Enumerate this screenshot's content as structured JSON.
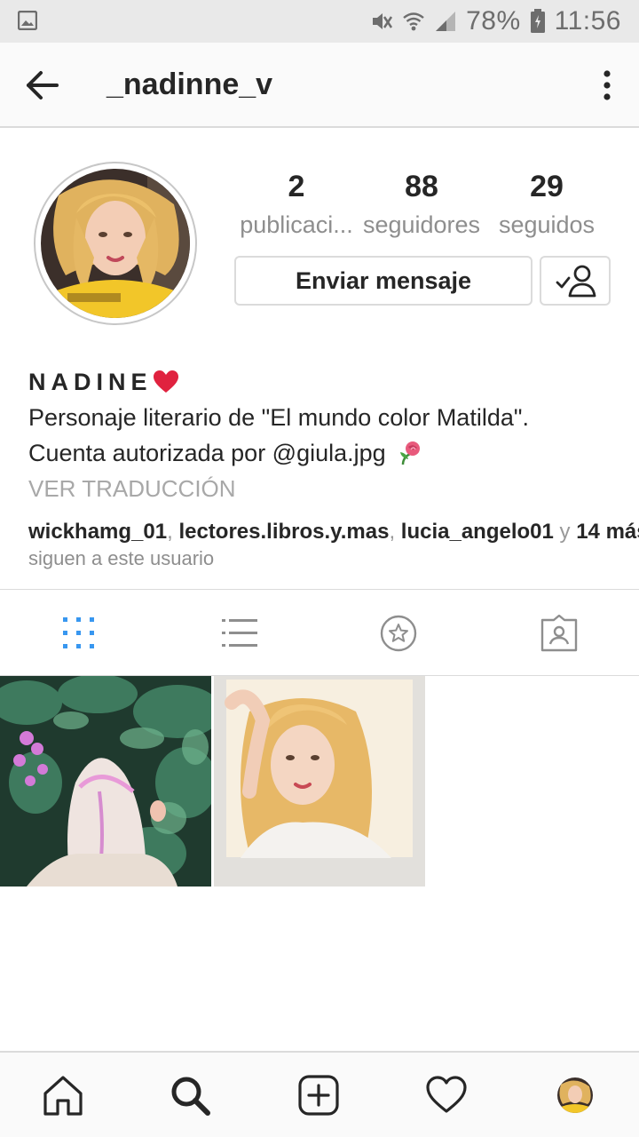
{
  "status_bar": {
    "battery": "78%",
    "time": "11:56",
    "icons": [
      "gallery-icon",
      "mute-icon",
      "wifi-icon",
      "signal-icon",
      "battery-icon"
    ]
  },
  "header": {
    "username": "_nadinne_v",
    "icons": [
      "back-arrow-icon",
      "more-vertical-icon"
    ]
  },
  "profile": {
    "stats": [
      {
        "value": "2",
        "label": "publicaci..."
      },
      {
        "value": "88",
        "label": "seguidores"
      },
      {
        "value": "29",
        "label": "seguidos"
      }
    ],
    "message_button": "Enviar mensaje",
    "following_icon": "following-check-icon"
  },
  "bio": {
    "name": "NADINE",
    "line1": "Personaje literario de \"El mundo color Matilda\".",
    "line2": "Cuenta autorizada por @giula.jpg",
    "translate": "VER TRADUCCIÓN",
    "followed_by": {
      "users": [
        "wickhamg_01",
        "lectores.libros.y.mas",
        "lucia_angelo01"
      ],
      "and": "y",
      "more": "14 más",
      "suffix": "siguen a este usuario"
    }
  },
  "tabs": [
    {
      "icon": "grid-icon",
      "active": true
    },
    {
      "icon": "list-icon",
      "active": false
    },
    {
      "icon": "saved-star-icon",
      "active": false
    },
    {
      "icon": "tagged-icon",
      "active": false
    }
  ],
  "bottom_nav": [
    "home-icon",
    "search-icon",
    "add-icon",
    "heart-icon",
    "profile-avatar"
  ],
  "colors": {
    "accent_blue": "#3897f0",
    "text": "#262626",
    "muted": "#8e8e8e",
    "border": "#dbdbdb",
    "status_bar_bg": "#e9e9e9"
  }
}
